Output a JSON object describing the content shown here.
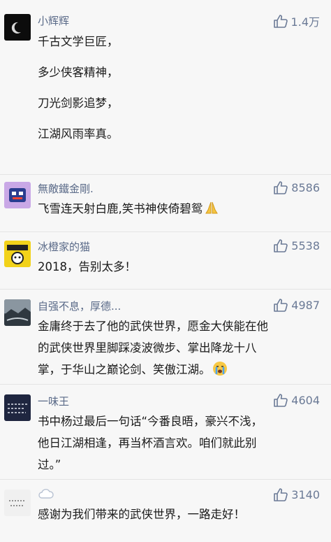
{
  "comments": [
    {
      "user": "小辉辉",
      "likes": "1.4万",
      "lines": [
        "千古文学巨匠，",
        "多少侠客精神，",
        "刀光剑影追梦，",
        "江湖风雨率真。"
      ],
      "avatar_icon": "crescent-moon-avatar",
      "avatar_color": "#0c0c0c"
    },
    {
      "user": "無敵鐵金剛.",
      "likes": "8586",
      "lines": [
        "飞雪连天射白鹿,笑书神侠倚碧鸳"
      ],
      "emoji": "praying-hands-emoji",
      "avatar_icon": "robot-avatar",
      "avatar_color": "#c9a8e6"
    },
    {
      "user": "冰橙家的猫",
      "likes": "5538",
      "lines": [
        "2018，告别太多！"
      ],
      "avatar_icon": "cartoon-avatar",
      "avatar_color": "#f2d21a"
    },
    {
      "user": "自强不息，厚德...",
      "likes": "4987",
      "lines": [
        "金庸终于去了他的武侠世界，愿金大侠能在他",
        "的武侠世界里脚踩凌波微步、掌出降龙十八",
        "掌，于华山之巅论剑、笑傲江湖。"
      ],
      "emoji": "crying-face-emoji",
      "avatar_icon": "landscape-avatar",
      "avatar_color": "#4a5560"
    },
    {
      "user": "一味王",
      "likes": "4604",
      "lines": [
        "书中杨过最后一句话“今番良晤，豪兴不浅，",
        "他日江湖相逢，再当杯酒言欢。咱们就此别",
        "过。”"
      ],
      "avatar_icon": "text-avatar",
      "avatar_color": "#1f2640"
    },
    {
      "user": "",
      "likes": "3140",
      "lines": [
        "感谢为我们带来的武侠世界，一路走好！"
      ],
      "name_icon": "cloud-icon",
      "avatar_icon": "text-avatar",
      "avatar_color": "#f0f0f0"
    }
  ],
  "colors": {
    "username": "#5a6a88",
    "likes": "#6b7a96",
    "text": "#1a1a1a",
    "background": "#f7f7f7",
    "divider": "#e4e4e4"
  },
  "icons": {
    "like": "thumbs-up-icon"
  }
}
